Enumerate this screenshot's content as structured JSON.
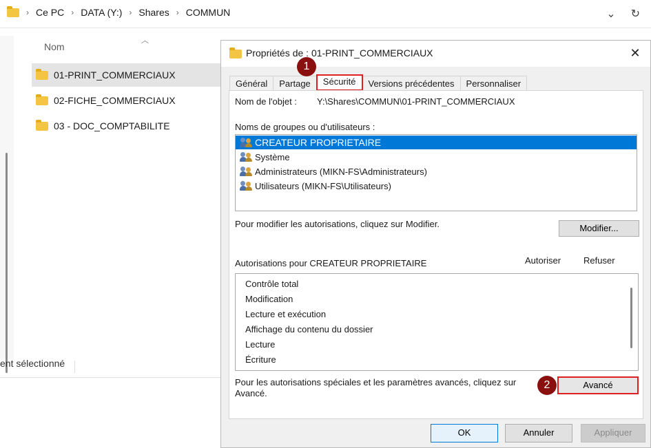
{
  "explorer": {
    "breadcrumb": [
      "Ce PC",
      "DATA (Y:)",
      "Shares",
      "COMMUN"
    ],
    "column_header": "Nom",
    "files": [
      "01-PRINT_COMMERCIAUX",
      "02-FICHE_COMMERCIAUX",
      "03 - DOC_COMPTABILITE"
    ],
    "status_text": "ent sélectionné"
  },
  "dialog": {
    "title": "Propriétés de : 01-PRINT_COMMERCIAUX",
    "close_glyph": "✕",
    "tabs": [
      "Général",
      "Partage",
      "Sécurité",
      "Versions précédentes",
      "Personnaliser"
    ],
    "active_tab": "Sécurité",
    "object_name_label": "Nom de l'objet :",
    "object_name_value": "Y:\\Shares\\COMMUN\\01-PRINT_COMMERCIAUX",
    "groups_label": "Noms de groupes ou d'utilisateurs :",
    "groups": [
      "CREATEUR PROPRIETAIRE",
      "Système",
      "Administrateurs (MIKN-FS\\Administrateurs)",
      "Utilisateurs (MIKN-FS\\Utilisateurs)"
    ],
    "modify_hint": "Pour modifier les autorisations, cliquez sur Modifier.",
    "modify_button": "Modifier...",
    "permissions_label": "Autorisations pour CREATEUR PROPRIETAIRE",
    "allow_label": "Autoriser",
    "deny_label": "Refuser",
    "permissions": [
      "Contrôle total",
      "Modification",
      "Lecture et exécution",
      "Affichage du contenu du dossier",
      "Lecture",
      "Écriture"
    ],
    "advanced_hint": "Pour les autorisations spéciales et les paramètres avancés, cliquez sur Avancé.",
    "advanced_button": "Avancé",
    "ok_button": "OK",
    "cancel_button": "Annuler",
    "apply_button": "Appliquer"
  },
  "markers": [
    "1",
    "2"
  ],
  "colors": {
    "highlight_red": "#e02020",
    "selection_blue": "#0078d7",
    "marker_red": "#8a1010"
  }
}
